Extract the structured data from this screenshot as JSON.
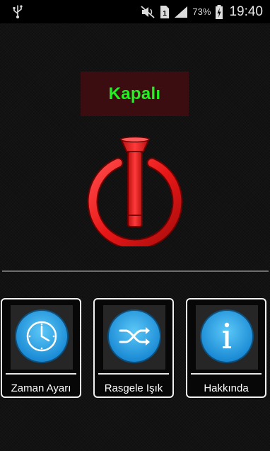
{
  "status_bar": {
    "battery_percent": "73%",
    "time": "19:40",
    "icons": [
      "usb-icon",
      "mute-icon",
      "sim-icon",
      "signal-icon",
      "battery-charging-icon"
    ]
  },
  "main": {
    "state_label": "Kapalı",
    "power_button_icon": "flashlight-power-icon"
  },
  "menu": {
    "items": [
      {
        "label": "Zaman Ayarı",
        "icon": "clock-icon"
      },
      {
        "label": "Rasgele Işık",
        "icon": "shuffle-icon"
      },
      {
        "label": "Hakkında",
        "icon": "info-icon"
      }
    ]
  },
  "colors": {
    "state_text": "#1df31d",
    "state_box": "#3b0d10",
    "power_red": "#ee1c1c",
    "menu_circle": "#2aa6ea"
  }
}
